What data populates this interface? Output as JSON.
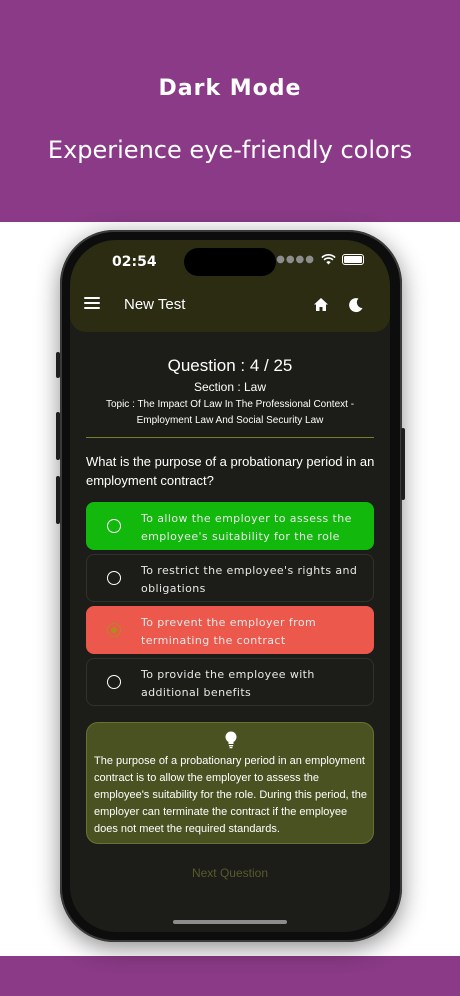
{
  "banner": {
    "title": "Dark Mode",
    "subtitle": "Experience eye-friendly colors"
  },
  "status_bar": {
    "time": "02:54"
  },
  "app_bar": {
    "title": "New Test"
  },
  "question": {
    "counter": "Question : 4 / 25",
    "section": "Section : Law",
    "topic": "Topic : The Impact Of Law In The Professional Context - Employment Law And Social Security Law",
    "text": "What is the purpose of a probationary period in an employment contract?"
  },
  "options": [
    {
      "label": "To allow the employer to assess the employee's suitability for the role",
      "state": "correct"
    },
    {
      "label": "To restrict the employee's rights and obligations",
      "state": "neutral"
    },
    {
      "label": "To prevent the employer from terminating the contract",
      "state": "selected-wrong"
    },
    {
      "label": "To provide the employee with additional benefits",
      "state": "neutral"
    }
  ],
  "explanation": {
    "icon": "lightbulb-icon",
    "text": "The purpose of a probationary period in an employment contract is to allow the employer to assess the employee's suitability for the role. During this period, the employer can terminate the contract if the employee does not meet the required standards."
  },
  "next_button": {
    "label": "Next Question"
  },
  "colors": {
    "banner": "#8a3a86",
    "correct": "#12b80c",
    "wrong": "#ec584b",
    "explanation_bg": "#4b5222",
    "app_bar": "#2b2c12"
  }
}
